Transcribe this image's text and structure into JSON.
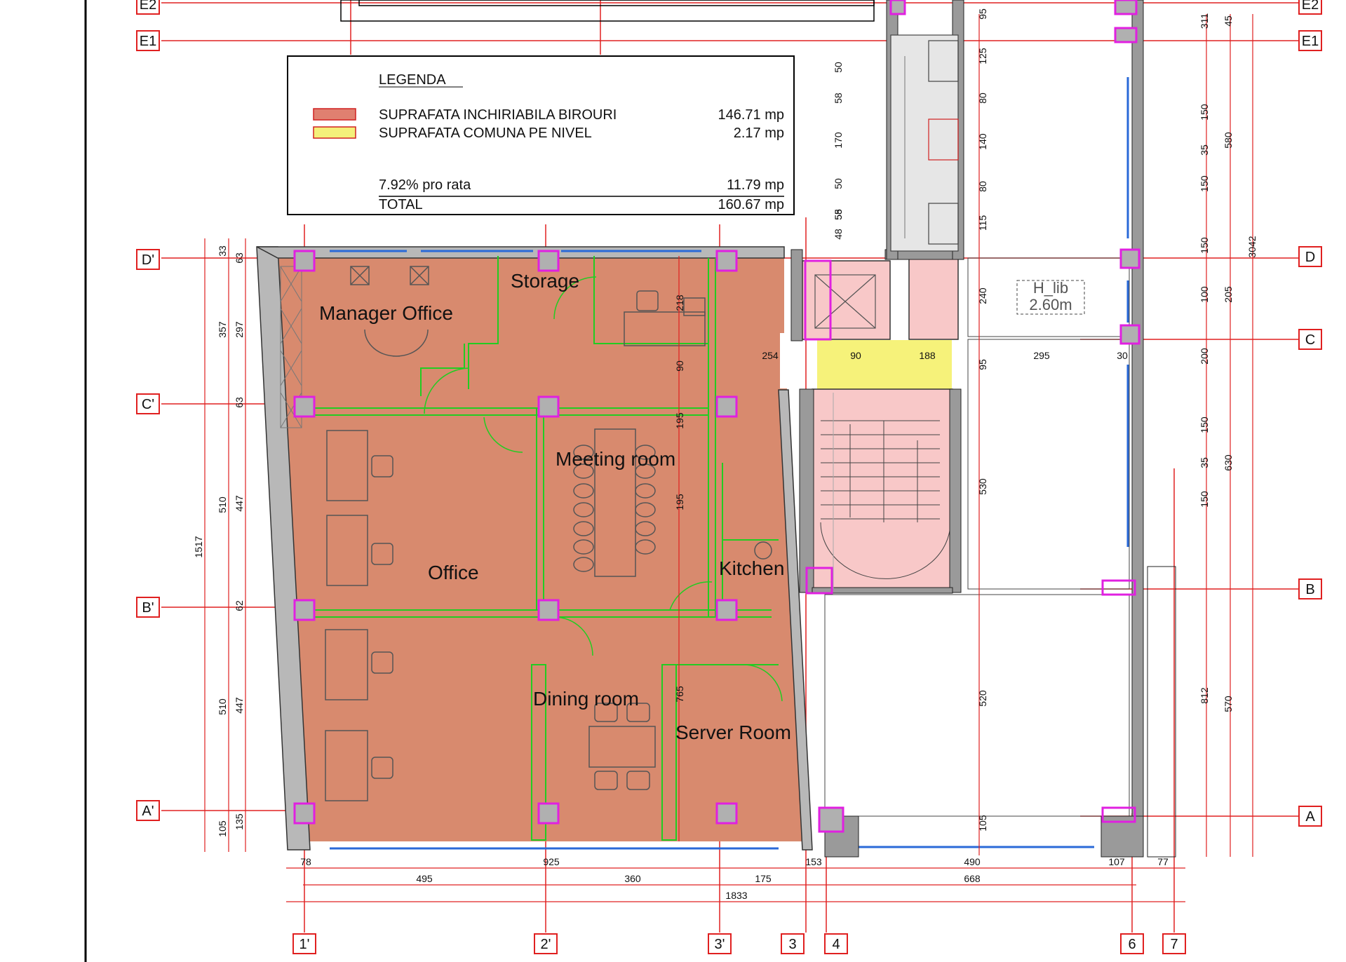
{
  "legend": {
    "title": "LEGENDA",
    "rows": [
      {
        "label": "SUPRAFATA INCHIRIABILA BIROURI",
        "value": "146.71 mp",
        "swatch": "#e08070"
      },
      {
        "label": "SUPRAFATA COMUNA PE NIVEL",
        "value": "2.17 mp",
        "swatch": "#f4f07a"
      }
    ],
    "prorata_label": "7.92% pro rata",
    "prorata_value": "11.79 mp",
    "total_label": "TOTAL",
    "total_value": "160.67 mp"
  },
  "rooms": {
    "manager_office": "Manager Office",
    "storage": "Storage",
    "meeting_room": "Meeting room",
    "office": "Office",
    "kitchen": "Kitchen",
    "dining_room": "Dining room",
    "server_room": "Server Room"
  },
  "height_tag": {
    "line1": "H_lib",
    "line2": "2.60m"
  },
  "grid_labels": {
    "E2": "E2",
    "E1": "E1",
    "Dp": "D'",
    "Cp": "C'",
    "Bp": "B'",
    "Ap": "A'",
    "D": "D",
    "C": "C",
    "B": "B",
    "A": "A",
    "c1p": "1'",
    "c2p": "2'",
    "c3p": "3'",
    "c3": "3",
    "c4": "4",
    "c6": "6",
    "c7": "7"
  },
  "dims": {
    "bottom_row1": [
      "78",
      "925",
      "153",
      "490",
      "107",
      "77"
    ],
    "bottom_row2": [
      "495",
      "360",
      "175",
      "668"
    ],
    "bottom_total": "1833",
    "left_total": "1517",
    "left_col1": [
      "105",
      "510",
      "510",
      "357",
      "33"
    ],
    "left_col2": [
      "135",
      "447",
      "62",
      "447",
      "63",
      "297",
      "63"
    ],
    "right_col1": [
      "311",
      "150",
      "35",
      "150",
      "150",
      "100",
      "200",
      "150",
      "35",
      "150"
    ],
    "right_col2": [
      "45",
      "580",
      "205",
      "630",
      "570"
    ],
    "right_812": "812",
    "right_total": "3042",
    "core_col1": [
      "95",
      "125",
      "80",
      "140",
      "80",
      "115",
      "240",
      "95",
      "530",
      "520",
      "105"
    ],
    "core_col2": [
      "50",
      "58",
      "170",
      "50",
      "58",
      "48",
      "55"
    ],
    "mid_row": [
      "254",
      "90",
      "188",
      "295",
      "30"
    ],
    "vertical_misc": [
      "218",
      "90",
      "195",
      "195",
      "765"
    ]
  },
  "colors": {
    "office_fill": "#d88a6e",
    "common_fill": "#f6f27a",
    "core_fill": "#f8c8c8",
    "grid_red": "#e02020",
    "column_magenta": "#e020e0",
    "wall_green": "#22cc22",
    "glass_blue": "#2a6ad8"
  }
}
